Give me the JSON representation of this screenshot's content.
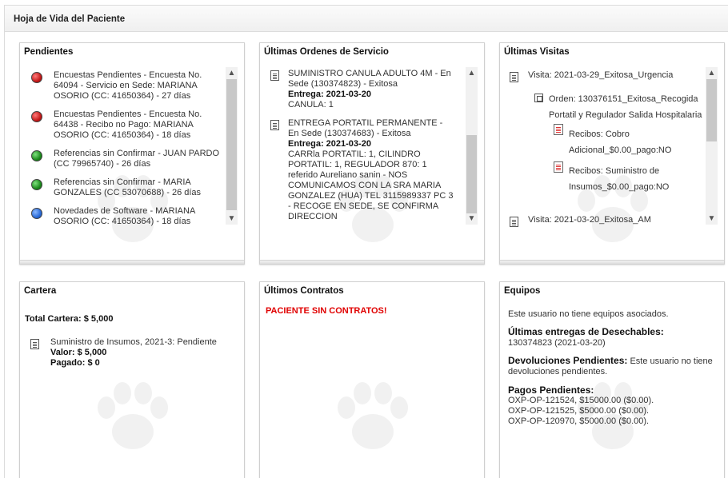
{
  "header": {
    "title": "Hoja de Vida del Paciente"
  },
  "pendientes": {
    "title": "Pendientes",
    "items": [
      {
        "status": "red",
        "text": "Encuestas Pendientes - Encuesta No. 64094 - Servicio en Sede: MARIANA OSORIO (CC: 41650364) - 27 días"
      },
      {
        "status": "red",
        "text": "Encuestas Pendientes - Encuesta No. 64438 - Recibo no Pago: MARIANA OSORIO (CC: 41650364) - 18 días"
      },
      {
        "status": "green",
        "text": "Referencias sin Confirmar - JUAN PARDO (CC 79965740) - 26 días"
      },
      {
        "status": "green",
        "text": "Referencias sin Confirmar - MARIA GONZALES (CC 53070688) - 26 días"
      },
      {
        "status": "blue",
        "text": "Novedades de Software - MARIANA OSORIO (CC: 41650364) - 18 días"
      }
    ]
  },
  "ordenes": {
    "title": "Últimas Ordenes de Servicio",
    "items": [
      {
        "title": "SUMINISTRO CANULA ADULTO 4M - En Sede (130374823) - Exitosa",
        "entrega": "Entrega: 2021-03-20",
        "detail": "CANULA: 1"
      },
      {
        "title": "ENTREGA PORTATIL PERMANENTE - En Sede (130374683) - Exitosa",
        "entrega": "Entrega: 2021-03-20",
        "detail": "CARRla PORTATIL: 1, CILINDRO PORTATIL: 1, REGULADOR 870: 1 referido Aureliano sanin - NOS COMUNICAMOS CON LA SRA MARIA GONZALEZ (HUA) TEL 3115989337 PC 3 - RECOGE EN SEDE, SE CONFIRMA DIRECCION"
      }
    ]
  },
  "visitas": {
    "title": "Últimas Visitas",
    "visita1": "Visita: 2021-03-29_Exitosa_Urgencia",
    "orden1_line1": "Orden: 130376151_Exitosa_Recogida",
    "orden1_line2": "Portatil y Regulador Salida Hospitalaria",
    "recibo1_line1": "Recibos: Cobro",
    "recibo1_line2": "Adicional_$0.00_pago:NO",
    "recibo2_line1": "Recibos: Suministro de",
    "recibo2_line2": "Insumos_$0.00_pago:NO",
    "visita2": "Visita: 2021-03-20_Exitosa_AM"
  },
  "cartera": {
    "title": "Cartera",
    "total": "Total Cartera: $ 5,000",
    "item": "Suministro de Insumos, 2021-3: Pendiente",
    "valor": "Valor: $ 5,000",
    "pagado": "Pagado: $ 0"
  },
  "contratos": {
    "title": "Últimos Contratos",
    "empty": "PACIENTE SIN CONTRATOS!"
  },
  "equipos": {
    "title": "Equipos",
    "no_equipos": "Este usuario no tiene equipos asociados.",
    "entregas_label": "Últimas entregas de Desechables:",
    "entregas_value": "130374823 (2021-03-20)",
    "devoluciones_label": "Devoluciones Pendientes:",
    "devoluciones_value": "Este usuario no tiene devoluciones pendientes.",
    "pagos_label": "Pagos Pendientes:",
    "pagos": [
      "OXP-OP-121524, $15000.00 ($0.00).",
      "OXP-OP-121525, $5000.00 ($0.00).",
      "OXP-OP-120970, $5000.00 ($0.00)."
    ]
  },
  "colors": {
    "status_red": "#c41a1a",
    "status_green": "#1d8a1d",
    "status_blue": "#2a6ad6",
    "alert_red": "#e00000"
  }
}
